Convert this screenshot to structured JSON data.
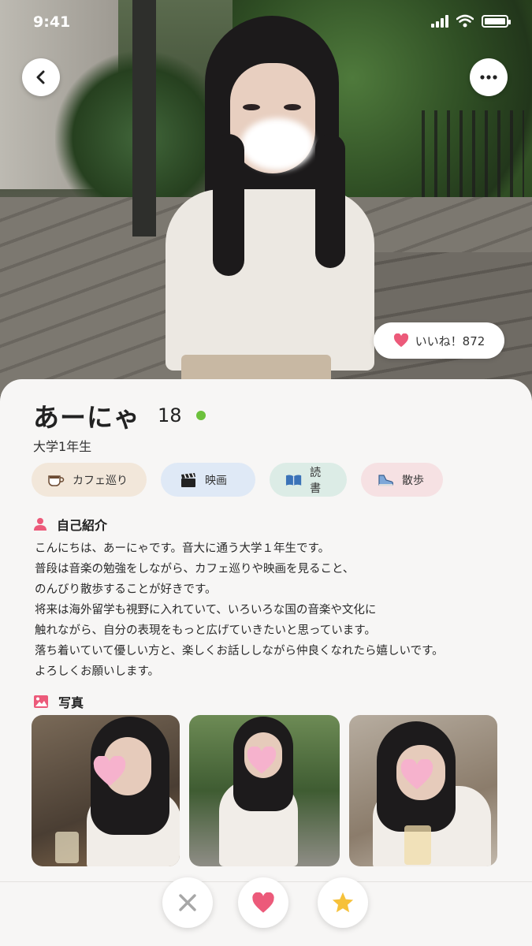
{
  "status_bar": {
    "time": "9:41"
  },
  "profile": {
    "name": "あーにゃ",
    "age": "18",
    "school": "大学1年生",
    "likes_label": "いいね！872",
    "online_color": "#6cc13c"
  },
  "tags": [
    {
      "icon": "coffee-cup-icon",
      "label": "カフェ巡り"
    },
    {
      "icon": "clapperboard-icon",
      "label": "映画"
    },
    {
      "icon": "book-icon",
      "label": "読書"
    },
    {
      "icon": "sneaker-icon",
      "label": "散歩"
    }
  ],
  "intro": {
    "title": "自己紹介",
    "lines": [
      "こんにちは、あーにゃです。音大に通う大学１年生です。",
      "普段は音楽の勉強をしながら、カフェ巡りや映画を見ること、",
      "のんびり散歩することが好きです。",
      "将来は海外留学も視野に入れていて、いろいろな国の音楽や文化に",
      "触れながら、自分の表現をもっと広げていきたいと思っています。",
      "落ち着いていて優しい方と、楽しくお話ししながら仲良くなれたら嬉しいです。",
      "よろしくお願いします。"
    ]
  },
  "photos": {
    "title": "写真"
  },
  "colors": {
    "accent": "#ec5a7a",
    "star": "#f6c13a"
  }
}
